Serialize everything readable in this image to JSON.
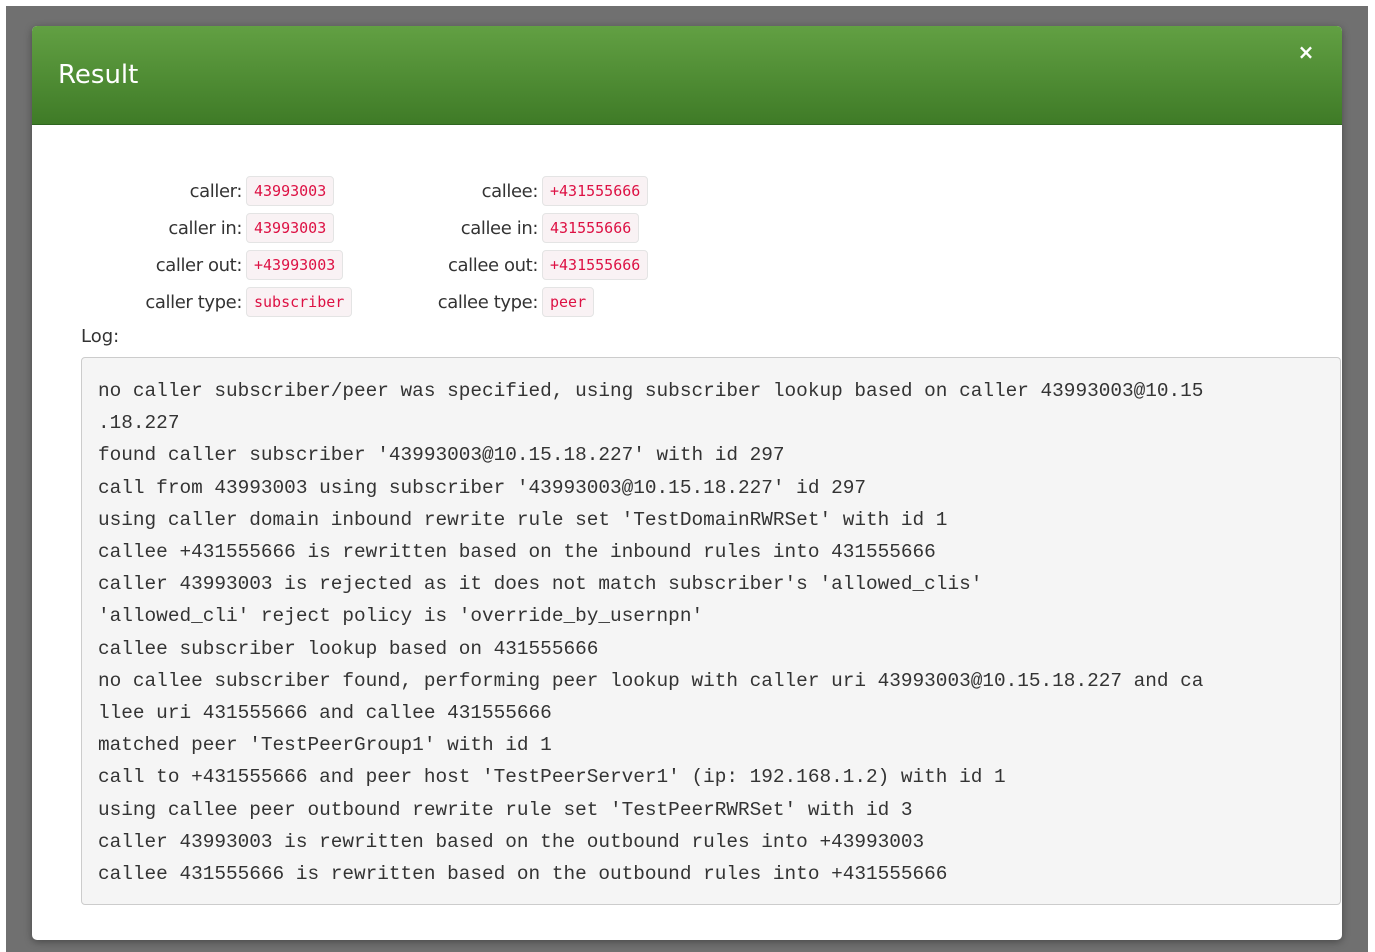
{
  "dialog": {
    "title": "Result",
    "close_label": "×"
  },
  "fields": {
    "caller": {
      "label": "caller:",
      "value": "43993003"
    },
    "caller_in": {
      "label": "caller in:",
      "value": "43993003"
    },
    "caller_out": {
      "label": "caller out:",
      "value": "+43993003"
    },
    "caller_type": {
      "label": "caller type:",
      "value": "subscriber"
    },
    "callee": {
      "label": "callee:",
      "value": "+431555666"
    },
    "callee_in": {
      "label": "callee in:",
      "value": "431555666"
    },
    "callee_out": {
      "label": "callee out:",
      "value": "+431555666"
    },
    "callee_type": {
      "label": "callee type:",
      "value": "peer"
    }
  },
  "log": {
    "label": "Log:",
    "lines": [
      "no caller subscriber/peer was specified, using subscriber lookup based on caller 43993003@10.15",
      ".18.227",
      "found caller subscriber '43993003@10.15.18.227' with id 297",
      "call from 43993003 using subscriber '43993003@10.15.18.227' id 297",
      "using caller domain inbound rewrite rule set 'TestDomainRWRSet' with id 1",
      "callee +431555666 is rewritten based on the inbound rules into 431555666",
      "caller 43993003 is rejected as it does not match subscriber's 'allowed_clis'",
      "'allowed_cli' reject policy is 'override_by_usernpn'",
      "callee subscriber lookup based on 431555666",
      "no callee subscriber found, performing peer lookup with caller uri 43993003@10.15.18.227 and ca",
      "llee uri 431555666 and callee 431555666",
      "matched peer 'TestPeerGroup1' with id 1",
      "call to +431555666 and peer host 'TestPeerServer1' (ip: 192.168.1.2) with id 1",
      "using callee peer outbound rewrite rule set 'TestPeerRWRSet' with id 3",
      "caller 43993003 is rewritten based on the outbound rules into +43993003",
      "callee 431555666 is rewritten based on the outbound rules into +431555666"
    ]
  }
}
